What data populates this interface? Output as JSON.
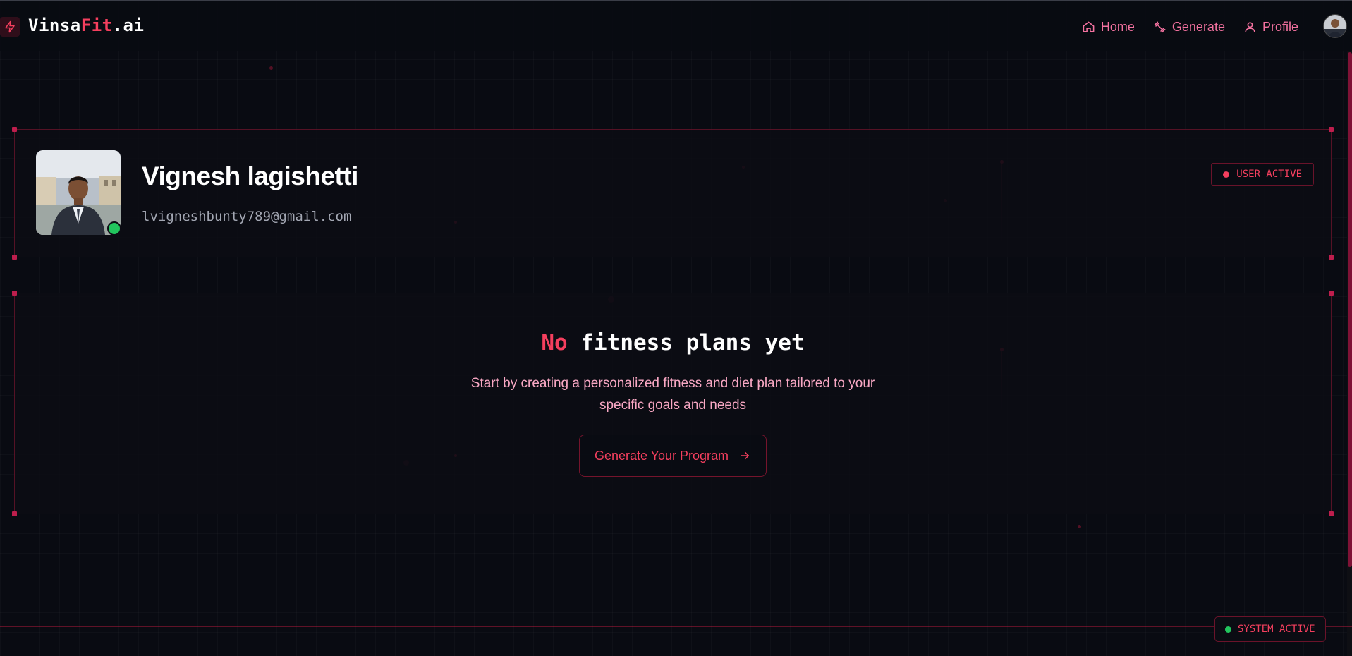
{
  "brand": {
    "part1": "Vinsa",
    "part2": "Fit",
    "part3": ".ai"
  },
  "nav": {
    "home": "Home",
    "generate": "Generate",
    "profile": "Profile"
  },
  "profile": {
    "name": "Vignesh lagishetti",
    "email": "lvigneshbunty789@gmail.com",
    "status_badge": "USER ACTIVE"
  },
  "empty_state": {
    "title_accent": "No",
    "title_rest": " fitness plans yet",
    "description": "Start by creating a personalized fitness and diet plan tailored to your specific goals and needs",
    "button_label": "Generate Your Program"
  },
  "footer": {
    "system_status": "SYSTEM ACTIVE"
  },
  "colors": {
    "background": "#090b12",
    "accent": "#f43f5e",
    "status_green": "#22c55e"
  },
  "icons": [
    "zap-icon",
    "home-icon",
    "dumbbell-icon",
    "user-icon",
    "arrow-right-icon"
  ]
}
